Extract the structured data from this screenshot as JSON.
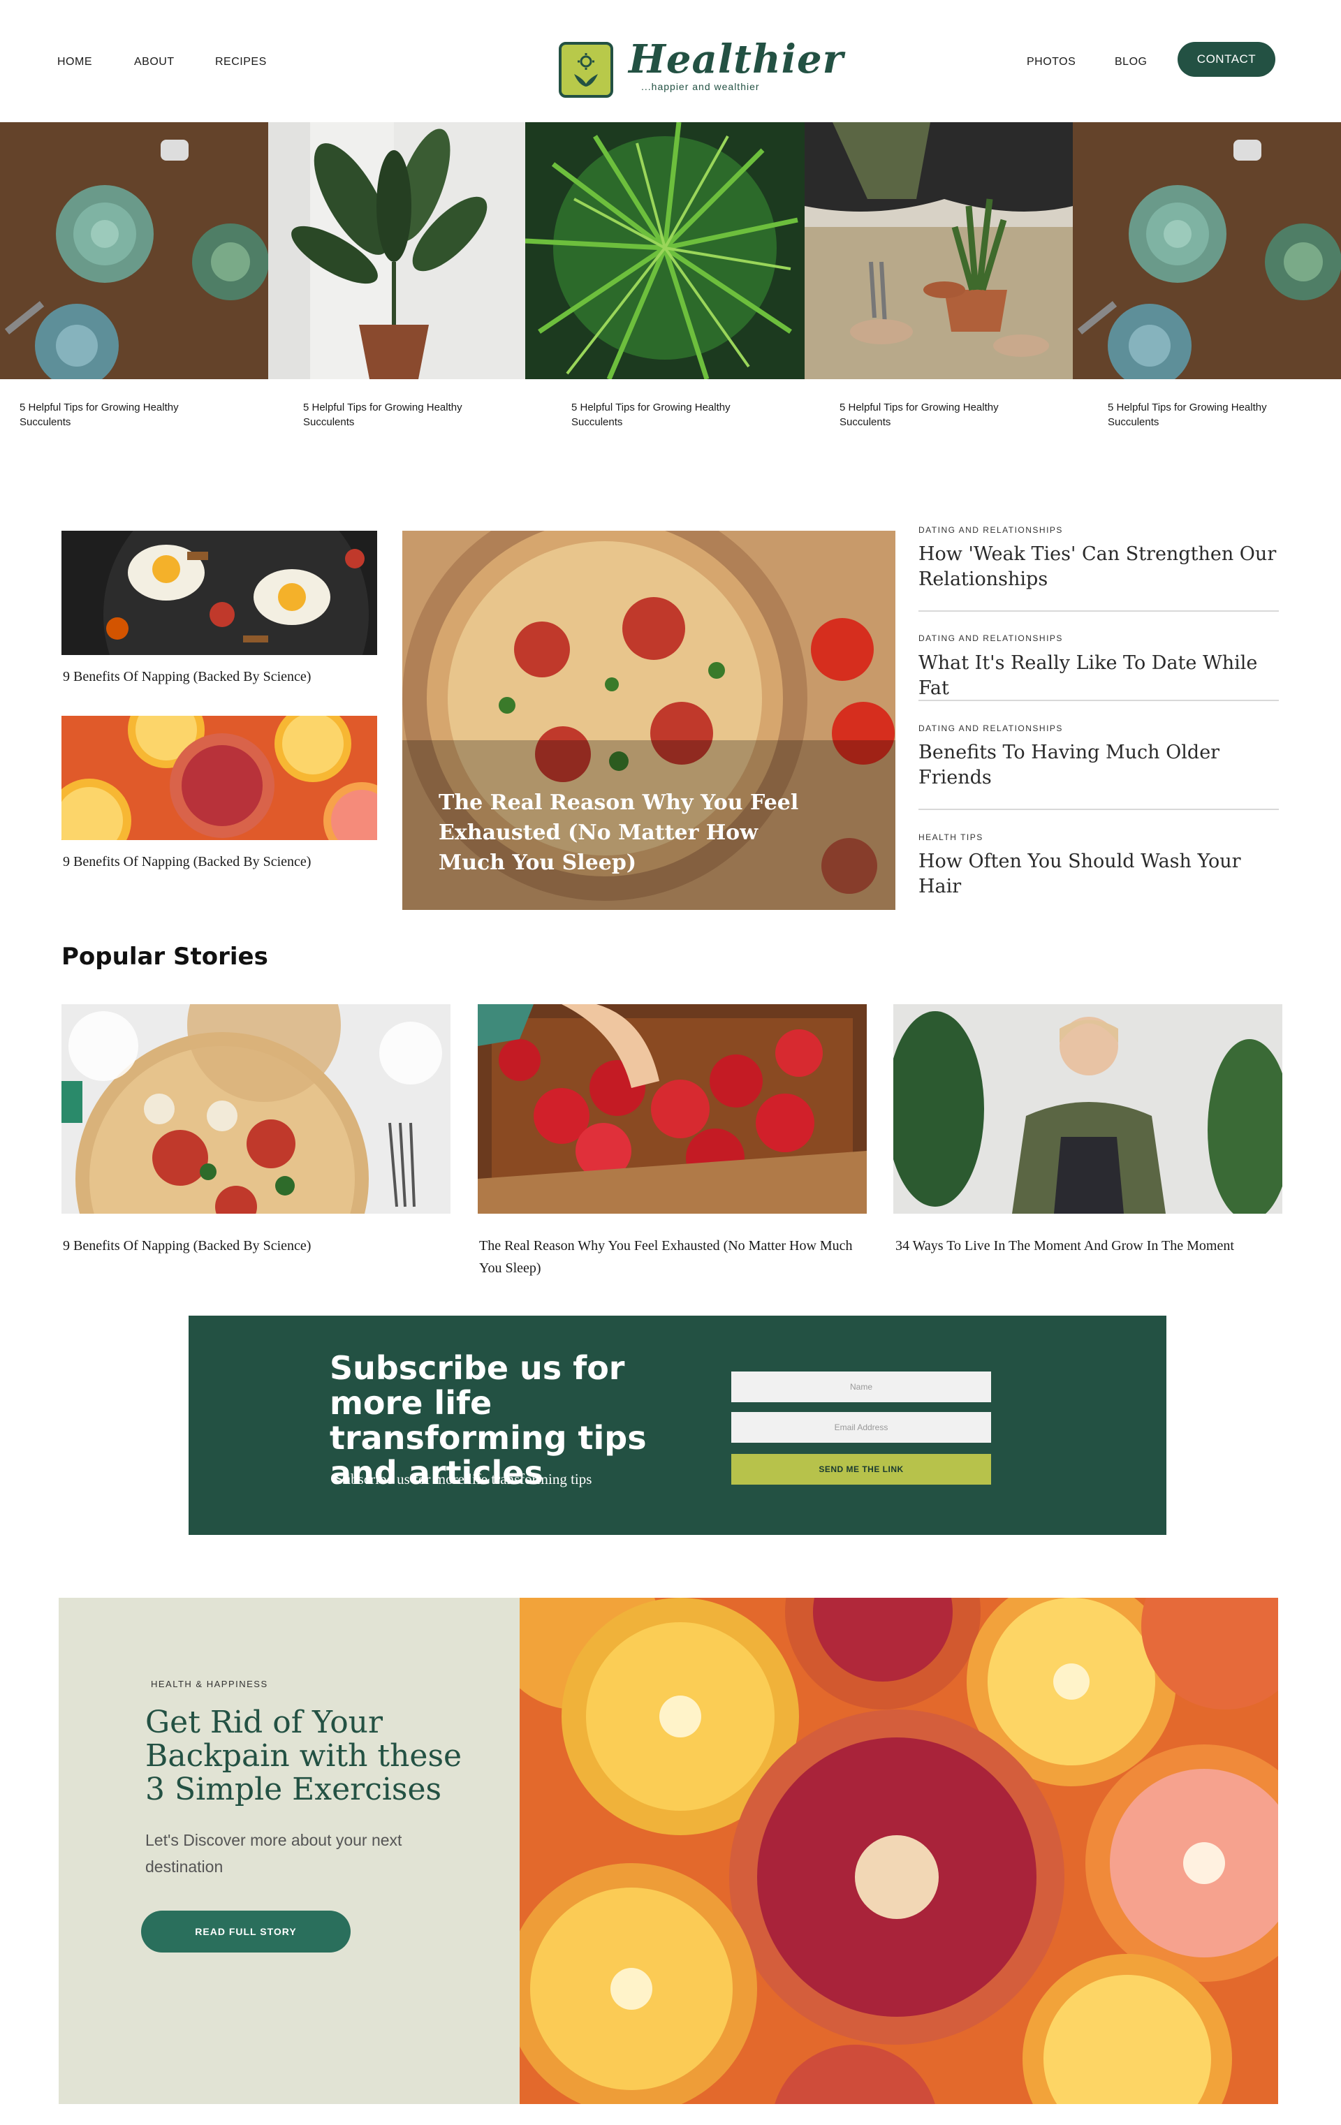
{
  "header": {
    "nav_left": [
      "HOME",
      "ABOUT",
      "RECIPES"
    ],
    "nav_right": [
      "PHOTOS",
      "BLOG"
    ],
    "contact_label": "CONTACT",
    "logo_title": "Healthier",
    "logo_tagline": "...happier and wealthier"
  },
  "strip": {
    "captions": [
      "5 Helpful Tips for Growing Healthy Succulents",
      "5 Helpful Tips for Growing Healthy Succulents",
      "5 Helpful Tips for Growing Healthy Succulents",
      "5 Helpful Tips for Growing Healthy Succulents",
      "5 Helpful Tips for Growing Healthy Succulents"
    ]
  },
  "feature": {
    "small_cards": [
      "9 Benefits Of Napping (Backed By Science)",
      "9 Benefits Of Napping (Backed By Science)"
    ],
    "big_title": "The Real Reason Why You Feel Exhausted (No Matter How Much You Sleep)",
    "side_articles": [
      {
        "category": "DATING AND RELATIONSHIPS",
        "title": "How 'Weak Ties' Can Strengthen Our Relationships"
      },
      {
        "category": "DATING AND RELATIONSHIPS",
        "title": "What It's Really Like To Date While Fat"
      },
      {
        "category": "DATING AND RELATIONSHIPS",
        "title": "Benefits To Having Much Older Friends"
      },
      {
        "category": "HEALTH TIPS",
        "title": "How Often You Should Wash Your Hair"
      }
    ]
  },
  "popular": {
    "heading": "Popular Stories",
    "stories": [
      "9 Benefits Of Napping (Backed By Science)",
      "The Real Reason Why You Feel Exhausted (No Matter How Much You Sleep)",
      "34 Ways To Live In The Moment And Grow In The Moment"
    ]
  },
  "subscribe": {
    "title": "Subscribe us for more life transforming tips and articles",
    "subtitle": "Subscribe us for more life transforming tips",
    "name_placeholder": "Name",
    "email_placeholder": "Email Address",
    "button_label": "SEND ME THE LINK"
  },
  "bottom_feature": {
    "category": "HEALTH & HAPPINESS",
    "title": "Get Rid of  Your Backpain with these 3 Simple Exercises",
    "text": "Let's Discover more about your next destination",
    "button_label": "READ FULL STORY"
  }
}
